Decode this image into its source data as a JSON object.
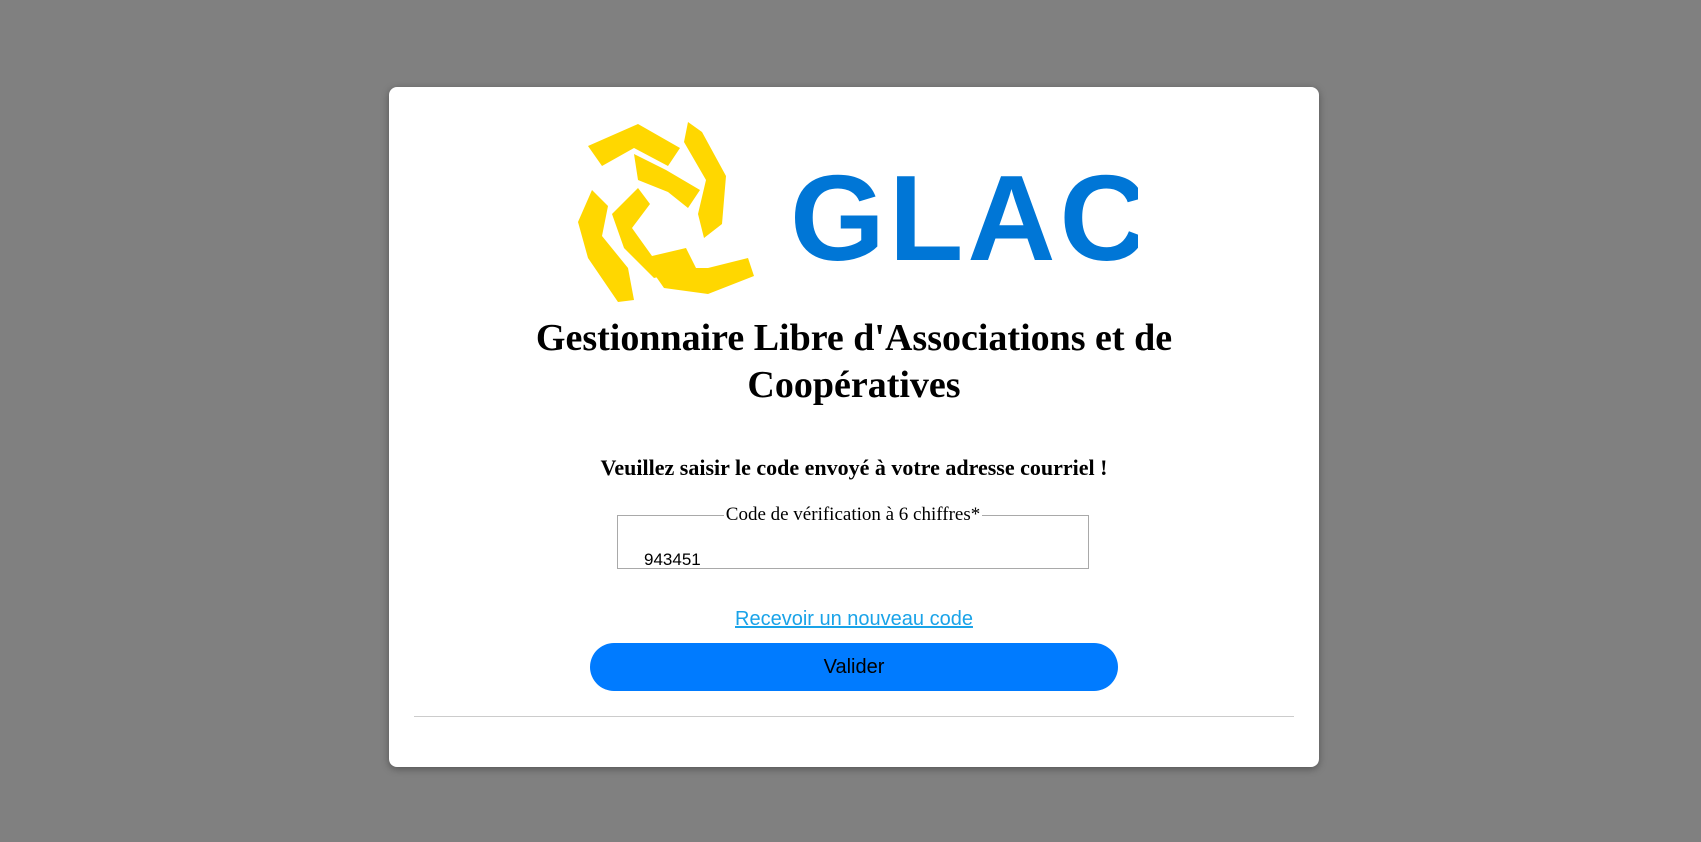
{
  "logo": {
    "text": "GLAC",
    "colors": {
      "emblem": "#ffd700",
      "wordmark": "#0076d6"
    }
  },
  "title": {
    "line1": "Gestionnaire Libre d'Associations et de",
    "line2": "Coopératives"
  },
  "instruction": "Veuillez saisir le code envoyé à votre adresse courriel !",
  "code_field": {
    "legend": "Code de vérification à 6 chiffres*",
    "value": "943451"
  },
  "resend_link": "Recevoir un nouveau code",
  "submit_button": "Valider",
  "colors": {
    "background": "#808080",
    "button": "#007bff",
    "link": "#1aa3e8"
  }
}
